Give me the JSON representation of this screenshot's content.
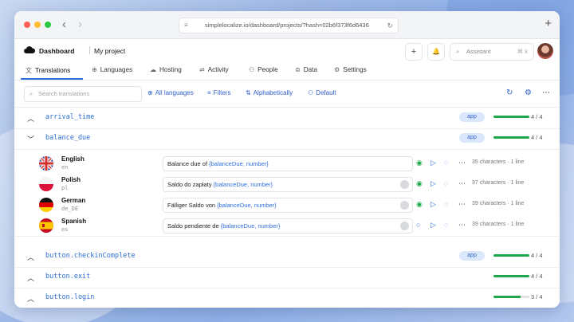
{
  "browser": {
    "url": "simplelocalize.io/dashboard/projects/?hash=02b6f373f6d6436",
    "back_icon": "‹",
    "forward_icon": "›",
    "reload_icon": "↻",
    "lock_icon": "≡",
    "new_tab_icon": "+"
  },
  "header": {
    "crumb_dashboard": "Dashboard",
    "crumb_project": "My project",
    "add_icon": "+",
    "bell_icon": "🔔",
    "assistant_label": "Assistant",
    "assistant_shortcut": "⌘ k"
  },
  "tabs": [
    {
      "label": "Translations",
      "icon": "文"
    },
    {
      "label": "Languages",
      "icon": "⊕"
    },
    {
      "label": "Hosting",
      "icon": "☁"
    },
    {
      "label": "Activity",
      "icon": "⇌"
    },
    {
      "label": "People",
      "icon": "⚇"
    },
    {
      "label": "Data",
      "icon": "⊜"
    },
    {
      "label": "Settings",
      "icon": "⚙"
    }
  ],
  "toolbar": {
    "search_placeholder": "Search translations",
    "all_languages": "All languages",
    "filters": "Filters",
    "sort": "Alphabetically",
    "view": "Default"
  },
  "keys": [
    {
      "name": "arrival_time",
      "badge": "app",
      "ratio": "4 / 4",
      "progress": 1.0
    },
    {
      "name": "balance_due",
      "badge": "app",
      "ratio": "4 / 4",
      "progress": 1.0
    },
    {
      "name": "button.checkinComplete",
      "badge": "app",
      "ratio": "4 / 4",
      "progress": 1.0
    },
    {
      "name": "button.exit",
      "badge": "",
      "ratio": "4 / 4",
      "progress": 1.0
    },
    {
      "name": "button.login",
      "badge": "",
      "ratio": "3 / 4",
      "progress": 0.75
    }
  ],
  "translations": [
    {
      "language": "English",
      "code": "en",
      "before": "Balance due of ",
      "placeholder": "{balanceDue, number}",
      "after": "",
      "chars": "35 characters · 1 line",
      "reviewed": true
    },
    {
      "language": "Polish",
      "code": "pl",
      "before": "Saldo do zapłaty ",
      "placeholder": "{balanceDue, number}",
      "after": "",
      "chars": "37 characters · 1 line",
      "reviewed": true
    },
    {
      "language": "German",
      "code": "de_DE",
      "before": "Fälliger Saldo von ",
      "placeholder": "{balanceDue, number}",
      "after": "",
      "chars": "39 characters · 1 line",
      "reviewed": true
    },
    {
      "language": "Spanish",
      "code": "es",
      "before": "Saldo pendiente de ",
      "placeholder": "{balanceDue, number}",
      "after": "",
      "chars": "39 characters · 1 line",
      "reviewed": false
    }
  ],
  "colors": {
    "accent": "#2f6fde",
    "success": "#1ea84b"
  }
}
